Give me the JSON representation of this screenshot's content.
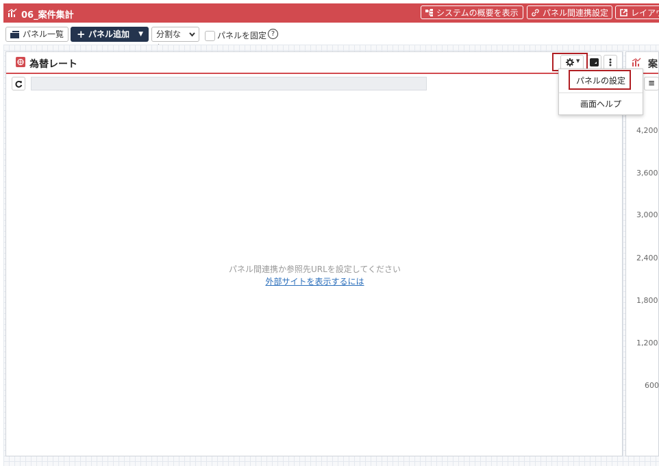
{
  "app": {
    "title": "06_案件集計"
  },
  "title_buttons": {
    "overview": "システムの概要を表示",
    "link_settings": "パネル間連携設定",
    "layout": "レイアウ"
  },
  "toolbar": {
    "panel_list": "パネル一覧",
    "add_panel": "パネル追加",
    "split": "分割なし",
    "fix_panel": "パネルを固定",
    "help": "?"
  },
  "panel": {
    "title": "為替レート",
    "url_value": "",
    "message": "パネル間連携か参照先URLを設定してください",
    "link": "外部サイトを表示するには"
  },
  "panel2": {
    "title": "案",
    "y_ticks": [
      "4,200",
      "3,600",
      "3,000",
      "2,400",
      "1,800",
      "1,200",
      "600"
    ]
  },
  "menu": {
    "panel_settings": "パネルの設定",
    "screen_help": "画面ヘルプ"
  },
  "colors": {
    "brand": "#d24a4f",
    "dark_button": "#24344e",
    "highlight": "#b01d22",
    "link": "#2a6ebb"
  }
}
